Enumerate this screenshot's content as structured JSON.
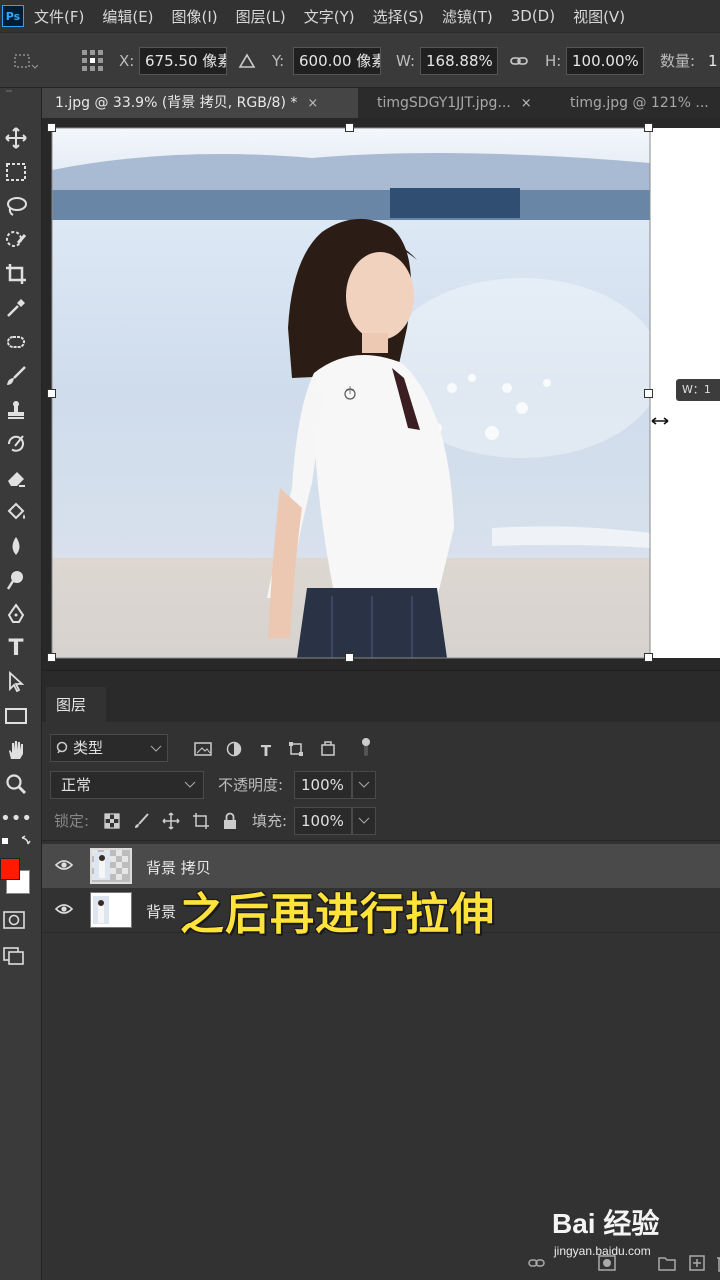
{
  "app": {
    "logo": "Ps"
  },
  "menu": [
    "文件(F)",
    "编辑(E)",
    "图像(I)",
    "图层(L)",
    "文字(Y)",
    "选择(S)",
    "滤镜(T)",
    "3D(D)",
    "视图(V)"
  ],
  "options": {
    "x_label": "X:",
    "x_value": "675.50 像素",
    "y_label": "Y:",
    "y_value": "600.00 像素",
    "w_label": "W:",
    "w_value": "168.88%",
    "h_label": "H:",
    "h_value": "100.00%",
    "count_label": "数量:",
    "count_value": "1"
  },
  "tabs": [
    {
      "label": "1.jpg @ 33.9% (背景 拷贝, RGB/8) *",
      "close": "×"
    },
    {
      "label": "timgSDGY1JJT.jpg...",
      "close": "×"
    },
    {
      "label": "timg.jpg @ 121% ..."
    }
  ],
  "canvas": {
    "size_tip": "W：1"
  },
  "layers_panel": {
    "tab_label": "图层",
    "filter_kind": "类型",
    "blend_mode": "正常",
    "opacity_label": "不透明度:",
    "opacity_value": "100%",
    "lock_label": "锁定:",
    "fill_label": "填充:",
    "fill_value": "100%",
    "layers": [
      {
        "name": "背景 拷贝",
        "selected": true
      },
      {
        "name": "背景",
        "selected": false
      }
    ]
  },
  "subtitle": "之后再进行拉伸",
  "watermark": {
    "brand": "Bai 经验",
    "url": "jingyan.baidu.com"
  },
  "colors": {
    "foreground": "#ff1a00",
    "background": "#ffffff",
    "subtitle": "#ffe23a",
    "accent": "#31a8ff"
  },
  "icons": [
    "move-icon",
    "marquee-icon",
    "lasso-icon",
    "quick-select-icon",
    "crop-icon",
    "eyedropper-icon",
    "healing-icon",
    "brush-icon",
    "stamp-icon",
    "history-brush-icon",
    "eraser-icon",
    "bucket-icon",
    "blur-icon",
    "dodge-icon",
    "pen-icon",
    "type-icon",
    "path-select-icon",
    "rectangle-icon",
    "hand-icon",
    "zoom-icon",
    "more-icon"
  ]
}
